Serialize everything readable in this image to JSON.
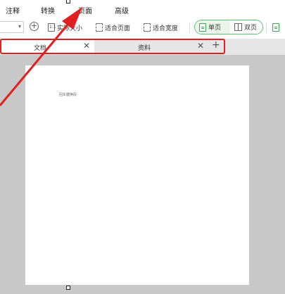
{
  "menu": {
    "items": [
      {
        "id": "annotate",
        "label": "注释"
      },
      {
        "id": "convert",
        "label": "转换"
      },
      {
        "id": "page",
        "label": "页面"
      },
      {
        "id": "advanced",
        "label": "高级"
      }
    ]
  },
  "toolbar": {
    "actual_size_label": "实际大小",
    "fit_page_label": "适合页面",
    "fit_width_label": "适合宽度",
    "single_page_label": "单页",
    "double_page_label": "双页"
  },
  "tabs": [
    {
      "label": "文档",
      "active": true
    },
    {
      "label": "资料",
      "active": false
    }
  ],
  "document": {
    "page_text": "回车键换段"
  },
  "colors": {
    "highlight": "#e02020",
    "accent_green": "#3aa655",
    "workspace_bg": "#c8c8c8"
  }
}
